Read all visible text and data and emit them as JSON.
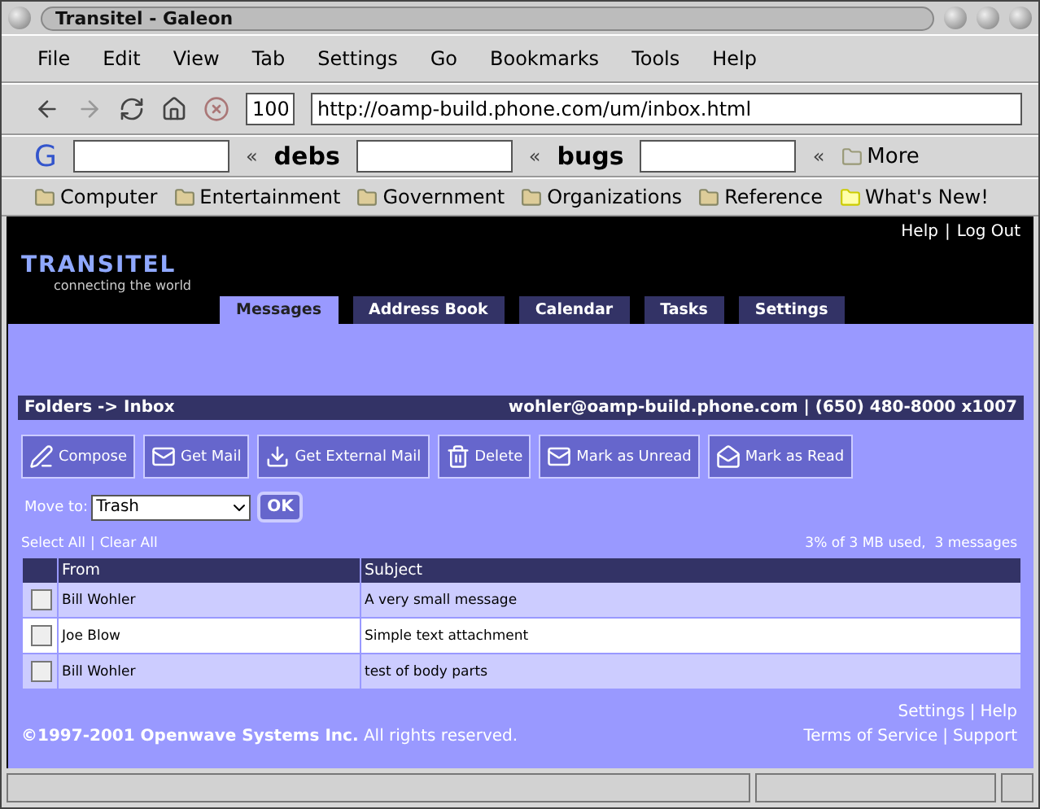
{
  "window": {
    "title": "Transitel - Galeon"
  },
  "menu": [
    "File",
    "Edit",
    "View",
    "Tab",
    "Settings",
    "Go",
    "Bookmarks",
    "Tools",
    "Help"
  ],
  "nav": {
    "zoom": "100",
    "url": "http://oamp-build.phone.com/um/inbox.html"
  },
  "search_bar": [
    {
      "kind": "google",
      "label": "G",
      "arrow": "«"
    },
    {
      "kind": "debian",
      "label": "debs",
      "arrow": "«"
    },
    {
      "kind": "debian",
      "label": "bugs",
      "arrow": "«"
    }
  ],
  "search_more": "More",
  "bookmarks": [
    {
      "label": "Computer",
      "kind": "folder"
    },
    {
      "label": "Entertainment",
      "kind": "folder"
    },
    {
      "label": "Government",
      "kind": "folder"
    },
    {
      "label": "Organizations",
      "kind": "folder"
    },
    {
      "label": "Reference",
      "kind": "folder"
    },
    {
      "label": "What's New!",
      "kind": "new"
    }
  ],
  "page": {
    "link_separator": "|",
    "header_links": [
      "Help",
      "Log Out"
    ],
    "logo": {
      "name": "TRANSITEL",
      "tagline": "connecting the world"
    },
    "tabs": [
      {
        "label": "Messages",
        "selected": true
      },
      {
        "label": "Address Book",
        "selected": false
      },
      {
        "label": "Calendar",
        "selected": false
      },
      {
        "label": "Tasks",
        "selected": false
      },
      {
        "label": "Settings",
        "selected": false
      }
    ],
    "breadcrumb": "Folders -> Inbox",
    "account": "wohler@oamp-build.phone.com | (650) 480-8000 x1007",
    "actions": [
      {
        "label": "Compose",
        "kind": "compose"
      },
      {
        "label": "Get Mail",
        "kind": "get"
      },
      {
        "label": "Get External Mail",
        "kind": "external"
      },
      {
        "label": "Delete",
        "kind": "delete"
      },
      {
        "label": "Mark as Unread",
        "kind": "unread"
      },
      {
        "label": "Mark as Read",
        "kind": "read"
      }
    ],
    "move_to": {
      "label": "Move to:",
      "value": "Trash",
      "button": "OK"
    },
    "select_links": [
      "Select All",
      "Clear All"
    ],
    "quota": "3% of 3 MB used,  3 messages",
    "columns": [
      "From",
      "Subject"
    ],
    "rows": [
      {
        "from": "Bill Wohler",
        "subject": "A very small message",
        "checked": false,
        "highlighted": false
      },
      {
        "from": "Joe Blow",
        "subject": "Simple text attachment",
        "checked": false,
        "highlighted": true
      },
      {
        "from": "Bill Wohler",
        "subject": "test of body parts",
        "checked": false,
        "highlighted": false
      }
    ],
    "footer_links": [
      "Settings",
      "Help"
    ],
    "copyright": "**©1997-2001 Openwave Systems Inc.** All rights reserved.",
    "footer_links_2": [
      "Terms of Service",
      "Support"
    ]
  }
}
